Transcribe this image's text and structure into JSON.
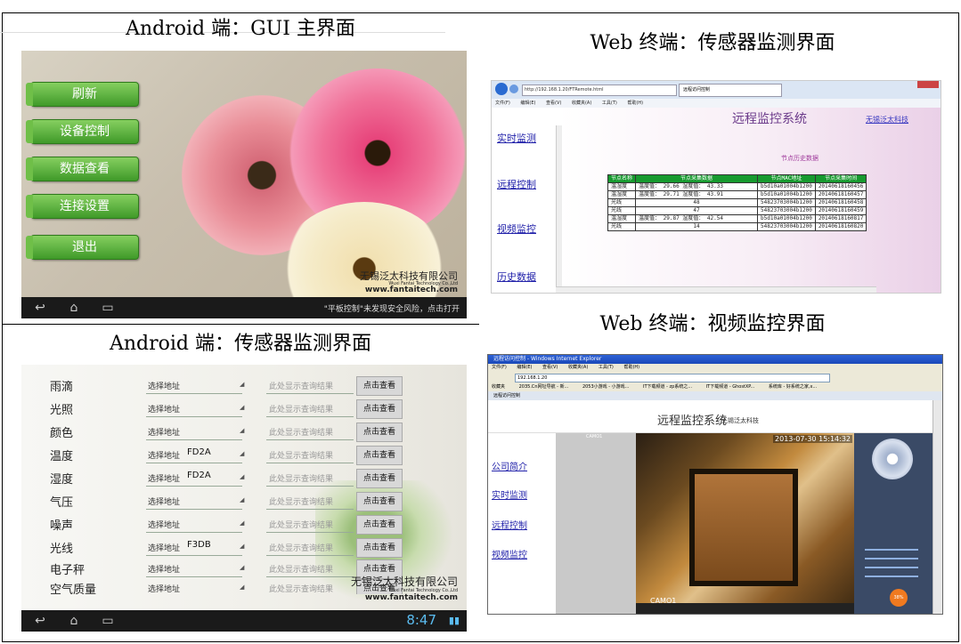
{
  "top_caption": "",
  "captions": {
    "android_home": "Android 端：GUI 主界面",
    "web_sensor": "Web 终端：传感器监测界面",
    "android_sensor": "Android 端：传感器监测界面",
    "web_video": "Web 终端：视频监控界面"
  },
  "android_home": {
    "buttons": [
      "刷新",
      "设备控制",
      "数据查看",
      "连接设置",
      "退出"
    ],
    "watermark_cn": "无锡泛太科技有限公司",
    "watermark_en": "Wuxi Fantai Technology Co.,Ltd",
    "watermark_url": "www.fantaitech.com",
    "notice": "\"平板控制\"未发现安全风险，点击打开"
  },
  "android_sensor": {
    "addr_label": "选择地址",
    "result_placeholder": "此处显示查询结果",
    "query_button": "点击查看",
    "rows": [
      {
        "name": "雨滴",
        "addr": ""
      },
      {
        "name": "光照",
        "addr": ""
      },
      {
        "name": "颜色",
        "addr": ""
      },
      {
        "name": "温度",
        "addr": "FD2A"
      },
      {
        "name": "湿度",
        "addr": "FD2A"
      },
      {
        "name": "气压",
        "addr": ""
      },
      {
        "name": "噪声",
        "addr": ""
      },
      {
        "name": "光线",
        "addr": "F3DB"
      },
      {
        "name": "电子秤",
        "addr": ""
      },
      {
        "name": "空气质量",
        "addr": ""
      }
    ],
    "watermark_cn": "无锡泛太科技有限公司",
    "watermark_en": "Wuxi Fantai Technology Co.,Ltd",
    "watermark_url": "www.fantaitech.com",
    "clock": "8:47"
  },
  "web_sensor": {
    "url": "http://192.168.1.20/FTRemote.html",
    "tab_title": "远程访问控制",
    "menu": [
      "文件(F)",
      "编辑(E)",
      "查看(V)",
      "收藏夹(A)",
      "工具(T)",
      "帮助(H)"
    ],
    "title": "远程监控系统",
    "corp_link": "无锡泛太科技",
    "nav": [
      "实时监测",
      "远程控制",
      "视频监控",
      "历史数据"
    ],
    "history_title": "节点历史数据",
    "table_headers": [
      "节点名称",
      "节点采集数据",
      "节点MAC地址",
      "节点采集时间"
    ],
    "table_rows": [
      [
        "温湿度",
        "温度值： 29.66  湿度值： 43.33",
        "b5d10a01004b1200",
        "20140618160456"
      ],
      [
        "温湿度",
        "温度值： 29.71  湿度值： 43.91",
        "b5d10a01004b1200",
        "20140618160457"
      ],
      [
        "光线",
        "48",
        "54823703004b1200",
        "20140618160458"
      ],
      [
        "光线",
        "47",
        "54823703004b1200",
        "20140618160459"
      ],
      [
        "温湿度",
        "温度值： 29.87  湿度值： 42.54",
        "b5d10a01004b1200",
        "20140618160817"
      ],
      [
        "光线",
        "14",
        "54823703004b1200",
        "20140618160820"
      ]
    ]
  },
  "web_video": {
    "window_title": "远程访问控制 - Windows Internet Explorer",
    "menu": [
      "文件(F)",
      "编辑(E)",
      "查看(V)",
      "收藏夹(A)",
      "工具(T)",
      "帮助(H)"
    ],
    "url": "192.168.1.20",
    "favorites": [
      "收藏夹",
      "2035.Cn网址导航 - 新...",
      "2053小游戏 - 小游戏...",
      "IT下载频道 - zp系统之...",
      "IT下载频道 - GhostXP...",
      "系统库 - 好系统之家,x..."
    ],
    "tab_title": "远程访问控制",
    "title": "远程监控系统",
    "corp": "无锡泛太科技",
    "nav": [
      "公司简介",
      "实时监测",
      "远程控制",
      "视频监控"
    ],
    "cam_name": "CAMO1",
    "timestamp": "2013-07-30 15:14:32",
    "cam_label": "CAMO1",
    "badge": "38%"
  }
}
